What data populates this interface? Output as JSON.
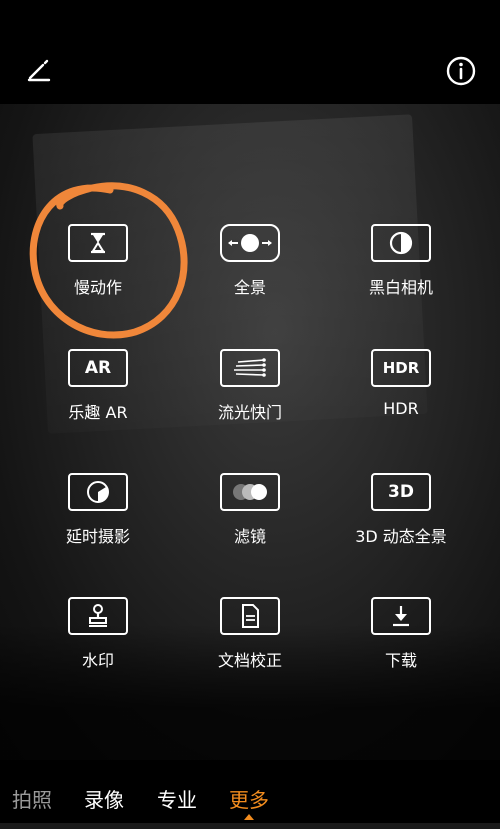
{
  "modes": [
    {
      "label": "慢动作",
      "icon": "hourglass-icon"
    },
    {
      "label": "全景",
      "icon": "panorama-icon"
    },
    {
      "label": "黑白相机",
      "icon": "half-circle-icon"
    },
    {
      "label": "乐趣 AR",
      "icon": "ar-icon",
      "icon_text": "AR"
    },
    {
      "label": "流光快门",
      "icon": "light-trail-icon"
    },
    {
      "label": "HDR",
      "icon": "hdr-icon",
      "icon_text": "HDR"
    },
    {
      "label": "延时摄影",
      "icon": "timelapse-icon"
    },
    {
      "label": "滤镜",
      "icon": "filter-circles-icon"
    },
    {
      "label": "3D 动态全景",
      "icon": "3d-icon",
      "icon_text": "3D"
    },
    {
      "label": "水印",
      "icon": "stamp-icon"
    },
    {
      "label": "文档校正",
      "icon": "document-icon"
    },
    {
      "label": "下载",
      "icon": "download-icon"
    }
  ],
  "tabs": [
    {
      "label": "拍照"
    },
    {
      "label": "录像"
    },
    {
      "label": "专业"
    },
    {
      "label": "更多"
    }
  ],
  "active_tab": "更多",
  "colors": {
    "accent": "#f28c1e",
    "annotation": "#f0873a"
  }
}
